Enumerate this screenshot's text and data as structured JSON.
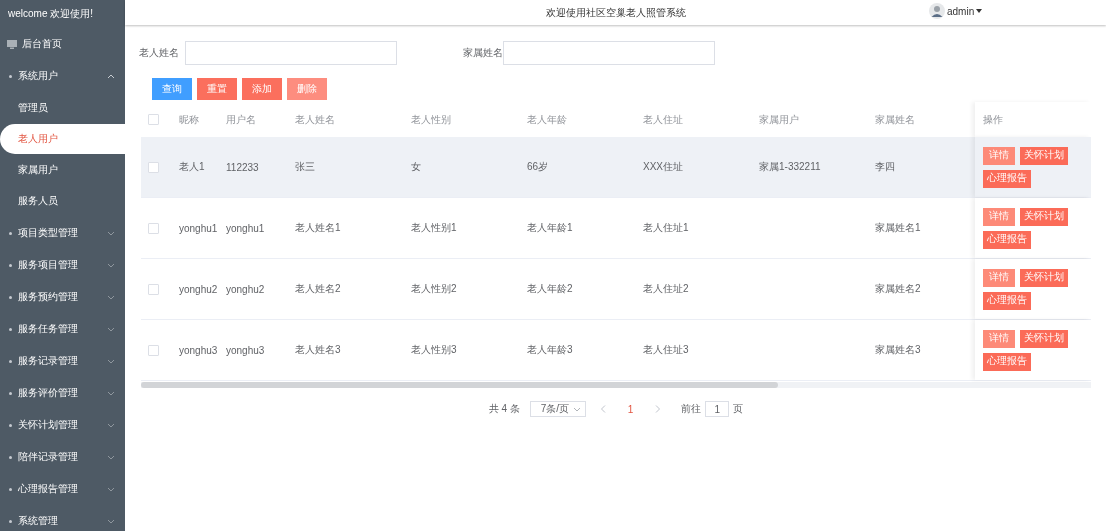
{
  "sidebar": {
    "title": "welcome 欢迎使用!",
    "items": [
      {
        "label": "后台首页",
        "kind": "home",
        "selected": false
      },
      {
        "label": "系统用户",
        "kind": "group",
        "expanded": true,
        "selected": false,
        "children": [
          {
            "label": "管理员",
            "selected": false
          },
          {
            "label": "老人用户",
            "selected": true
          },
          {
            "label": "家属用户",
            "selected": false
          },
          {
            "label": "服务人员",
            "selected": false
          }
        ]
      },
      {
        "label": "项目类型管理",
        "kind": "group",
        "expanded": false,
        "selected": false
      },
      {
        "label": "服务项目管理",
        "kind": "group",
        "expanded": false,
        "selected": false
      },
      {
        "label": "服务预约管理",
        "kind": "group",
        "expanded": false,
        "selected": false
      },
      {
        "label": "服务任务管理",
        "kind": "group",
        "expanded": false,
        "selected": false
      },
      {
        "label": "服务记录管理",
        "kind": "group",
        "expanded": false,
        "selected": false
      },
      {
        "label": "服务评价管理",
        "kind": "group",
        "expanded": false,
        "selected": false
      },
      {
        "label": "关怀计划管理",
        "kind": "group",
        "expanded": false,
        "selected": false
      },
      {
        "label": "陪伴记录管理",
        "kind": "group",
        "expanded": false,
        "selected": false
      },
      {
        "label": "心理报告管理",
        "kind": "group",
        "expanded": false,
        "selected": false
      },
      {
        "label": "系统管理",
        "kind": "group",
        "expanded": false,
        "selected": false
      }
    ]
  },
  "header": {
    "title": "欢迎使用社区空巢老人照管系统",
    "user": "admin"
  },
  "search": {
    "fields": [
      {
        "label": "老人姓名"
      },
      {
        "label": "家属姓名"
      }
    ]
  },
  "toolbar": [
    {
      "label": "查询",
      "kind": "primary",
      "disabled": false
    },
    {
      "label": "重置",
      "kind": "danger",
      "disabled": false
    },
    {
      "label": "添加",
      "kind": "danger",
      "disabled": false
    },
    {
      "label": "删除",
      "kind": "danger",
      "disabled": true
    }
  ],
  "table": {
    "select_all_checked": false,
    "columns": [
      "昵称",
      "用户名",
      "老人姓名",
      "老人性别",
      "老人年龄",
      "老人住址",
      "家属用户",
      "家属姓名",
      "操作"
    ],
    "rows": [
      {
        "checked": false,
        "hovered": true,
        "cells": [
          "老人1",
          "112233",
          "张三",
          "女",
          "66岁",
          "XXX住址",
          "家属1-332211",
          "李四"
        ],
        "actions": [
          {
            "label": "详情",
            "kind": "light"
          },
          {
            "label": "关怀计划",
            "kind": "strong"
          },
          {
            "label": "心理报告",
            "kind": "strong"
          }
        ]
      },
      {
        "checked": false,
        "hovered": false,
        "cells": [
          "yonghu1",
          "yonghu1",
          "老人姓名1",
          "老人性别1",
          "老人年龄1",
          "老人住址1",
          "",
          "家属姓名1"
        ],
        "actions": [
          {
            "label": "详情",
            "kind": "light"
          },
          {
            "label": "关怀计划",
            "kind": "strong"
          },
          {
            "label": "心理报告",
            "kind": "strong"
          }
        ]
      },
      {
        "checked": false,
        "hovered": false,
        "cells": [
          "yonghu2",
          "yonghu2",
          "老人姓名2",
          "老人性别2",
          "老人年龄2",
          "老人住址2",
          "",
          "家属姓名2"
        ],
        "actions": [
          {
            "label": "详情",
            "kind": "light"
          },
          {
            "label": "关怀计划",
            "kind": "strong"
          },
          {
            "label": "心理报告",
            "kind": "strong"
          }
        ]
      },
      {
        "checked": false,
        "hovered": false,
        "cells": [
          "yonghu3",
          "yonghu3",
          "老人姓名3",
          "老人性别3",
          "老人年龄3",
          "老人住址3",
          "",
          "家属姓名3"
        ],
        "actions": [
          {
            "label": "详情",
            "kind": "light"
          },
          {
            "label": "关怀计划",
            "kind": "strong"
          },
          {
            "label": "心理报告",
            "kind": "strong"
          }
        ]
      }
    ]
  },
  "pagination": {
    "total": "共 4 条",
    "page_size": "7条/页",
    "pages": [
      {
        "label": "1",
        "selected": true
      }
    ],
    "goto_label": "前往",
    "goto_value": "1",
    "page_suffix": "页"
  }
}
